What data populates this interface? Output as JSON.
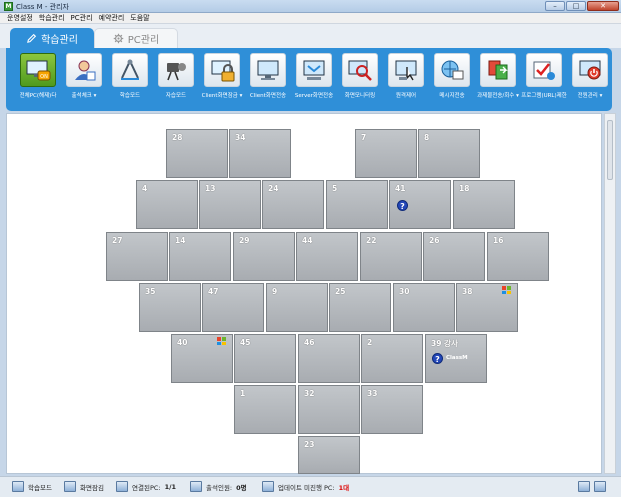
{
  "window": {
    "title": "Class M - 관리자",
    "minimize": "–",
    "maximize": "□",
    "close": "✕"
  },
  "menu": [
    "운영설정",
    "학습관리",
    "PC관리",
    "예약관리",
    "도움말"
  ],
  "tabs": [
    {
      "label": "학습관리",
      "active": true,
      "icon": "pencil-icon"
    },
    {
      "label": "PC관리",
      "active": false,
      "icon": "gear-icon"
    }
  ],
  "toolbar": [
    {
      "label": "전체PC(해제)다",
      "icon": "all-pc-on-icon",
      "selected": true
    },
    {
      "label": "출석체크 ▾",
      "icon": "attendance-icon"
    },
    {
      "label": "학습모드",
      "icon": "study-mode-icon"
    },
    {
      "label": "자습모드",
      "icon": "self-study-icon"
    },
    {
      "label": "Client화면잠금 ▾",
      "icon": "lock-icon"
    },
    {
      "label": "Client화면전송",
      "icon": "client-screen-icon"
    },
    {
      "label": "Server화면전송",
      "icon": "server-screen-icon"
    },
    {
      "label": "화면모니터링",
      "icon": "monitor-search-icon"
    },
    {
      "label": "원격제어",
      "icon": "remote-control-icon"
    },
    {
      "label": "메시지전송",
      "icon": "message-icon"
    },
    {
      "label": "과제물전송/회수 ▾",
      "icon": "assignment-icon"
    },
    {
      "label": "프로그램(URL)제한",
      "icon": "program-limit-icon"
    },
    {
      "label": "전원관리 ▾",
      "icon": "power-icon"
    }
  ],
  "pcs": [
    {
      "num": "28"
    },
    {
      "num": "34"
    },
    {
      "num": "7"
    },
    {
      "num": "8"
    },
    {
      "num": "4"
    },
    {
      "num": "13"
    },
    {
      "num": "24"
    },
    {
      "num": "5"
    },
    {
      "num": "41",
      "question": true
    },
    {
      "num": "18"
    },
    {
      "num": "27"
    },
    {
      "num": "14"
    },
    {
      "num": "29"
    },
    {
      "num": "44"
    },
    {
      "num": "22"
    },
    {
      "num": "26"
    },
    {
      "num": "16"
    },
    {
      "num": "35"
    },
    {
      "num": "47"
    },
    {
      "num": "9"
    },
    {
      "num": "25"
    },
    {
      "num": "30"
    },
    {
      "num": "38",
      "windows": true
    },
    {
      "num": "40",
      "windows": true
    },
    {
      "num": "45"
    },
    {
      "num": "46"
    },
    {
      "num": "2"
    },
    {
      "num": "39 강사",
      "question": true,
      "classm": "ClassM"
    },
    {
      "num": "1"
    },
    {
      "num": "32"
    },
    {
      "num": "33"
    },
    {
      "num": "23"
    }
  ],
  "status": {
    "mode_label": "학습모드",
    "screen_lock_label": "화면잠김",
    "connected_label": "연결된PC:",
    "connected_value": "1/1",
    "attendance_label": "출석인원:",
    "attendance_value": "0명",
    "update_label": "업데이트 미진행 PC:",
    "update_value": "1대"
  }
}
